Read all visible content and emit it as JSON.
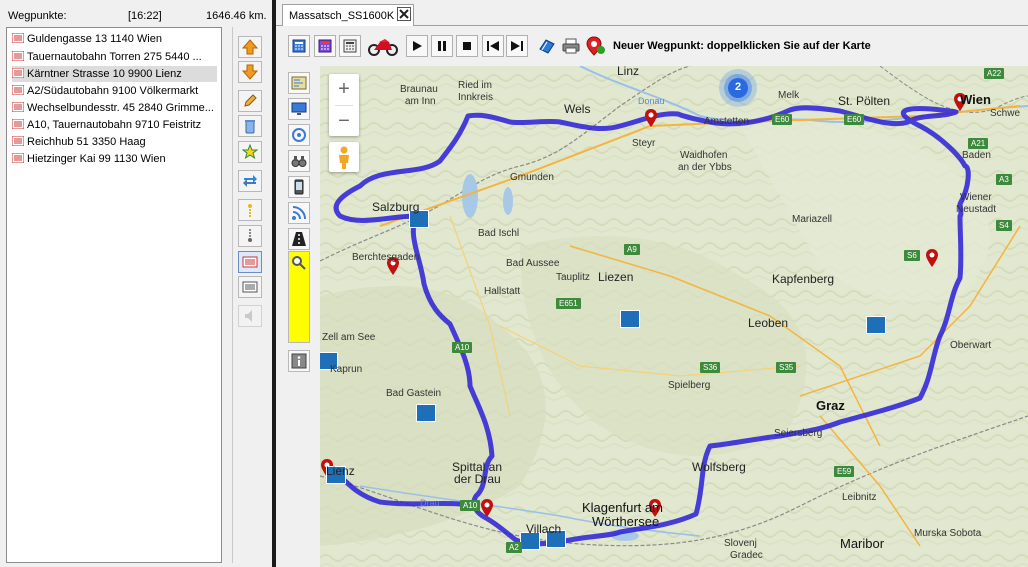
{
  "waypoints_panel": {
    "title": "Wegpunkte:",
    "time": "[16:22]",
    "distance": "1646.46 km.",
    "items": [
      {
        "label": "Guldengasse 13 1140 Wien"
      },
      {
        "label": "Tauernautobahn Torren 275 5440 ..."
      },
      {
        "label": "Kärntner Strasse 10 9900 Lienz",
        "selected": true
      },
      {
        "label": "A2/Südautobahn 9100 Völkermarkt"
      },
      {
        "label": "Wechselbundesstr. 45 2840 Grimme..."
      },
      {
        "label": "A10, Tauernautobahn 9710 Feistritz"
      },
      {
        "label": "Reichhub 51 3350 Haag"
      },
      {
        "label": "Hietzinger Kai 99 1130 Wien"
      }
    ]
  },
  "side_toolbar": {
    "icons": [
      "arrow-up-icon",
      "arrow-down-icon",
      "pencil-icon",
      "trash-icon",
      "star-icon",
      "swap-icon",
      "move-up-icon",
      "move-down-icon",
      "route-flag-icon",
      "route-list-icon",
      "speaker-icon"
    ]
  },
  "map_tab": {
    "label": "Massatsch_SS1600K"
  },
  "top_toolbar": {
    "hint": "Neuer Wegpunkt: doppelklicken Sie auf der Karte",
    "icons": [
      "calculator-icon",
      "calculator-red-icon",
      "calculator-grid-icon",
      "motorcycle-icon",
      "play-icon",
      "pause-icon",
      "stop-icon",
      "skip-back-icon",
      "skip-forward-icon",
      "edit-note-icon",
      "print-icon",
      "map-pin-icon"
    ]
  },
  "map_tools": {
    "icons": [
      "map-layer-icon",
      "monitor-icon",
      "target-icon",
      "binoculars-icon",
      "phone-icon",
      "rss-icon",
      "road-icon",
      "magnifier-icon",
      "info-icon"
    ]
  },
  "map": {
    "route_color": "#2a1fd8",
    "cluster_count": "2",
    "zoom_in": "+",
    "zoom_out": "−",
    "labels": [
      {
        "name": "label-linz",
        "text": "Linz"
      },
      {
        "name": "label-ried",
        "text": "Ried im"
      },
      {
        "name": "label-innkreis",
        "text": "Innkreis"
      },
      {
        "name": "label-braunau",
        "text": "Braunau"
      },
      {
        "name": "label-am-inn",
        "text": "am Inn"
      },
      {
        "name": "label-wels",
        "text": "Wels"
      },
      {
        "name": "label-donau",
        "text": "Donau"
      },
      {
        "name": "label-amstetten",
        "text": "Amstetten"
      },
      {
        "name": "label-melk",
        "text": "Melk"
      },
      {
        "name": "label-st-poelten",
        "text": "St. Pölten"
      },
      {
        "name": "label-wien",
        "text": "Wien"
      },
      {
        "name": "label-schwechat",
        "text": "Schwe"
      },
      {
        "name": "label-steyr",
        "text": "Steyr"
      },
      {
        "name": "label-waidhofen",
        "text": "Waidhofen"
      },
      {
        "name": "label-an-der-ybbs",
        "text": "an der Ybbs"
      },
      {
        "name": "label-baden",
        "text": "Baden"
      },
      {
        "name": "label-gmunden",
        "text": "Gmunden"
      },
      {
        "name": "label-wiener",
        "text": "Wiener"
      },
      {
        "name": "label-neustadt",
        "text": "Neustadt"
      },
      {
        "name": "label-salzburg",
        "text": "Salzburg"
      },
      {
        "name": "label-mariazell",
        "text": "Mariazell"
      },
      {
        "name": "label-bad-ischl",
        "text": "Bad Ischl"
      },
      {
        "name": "label-berchtesgaden",
        "text": "Berchtesgaden"
      },
      {
        "name": "label-bad-aussee",
        "text": "Bad Aussee"
      },
      {
        "name": "label-tauplitz",
        "text": "Tauplitz"
      },
      {
        "name": "label-liezen",
        "text": "Liezen"
      },
      {
        "name": "label-hallstatt",
        "text": "Hallstatt"
      },
      {
        "name": "label-kapfenberg",
        "text": "Kapfenberg"
      },
      {
        "name": "label-leoben",
        "text": "Leoben"
      },
      {
        "name": "label-zell-am-see",
        "text": "Zell am See"
      },
      {
        "name": "label-oberwart",
        "text": "Oberwart"
      },
      {
        "name": "label-kaprun",
        "text": "Kaprun"
      },
      {
        "name": "label-spielberg",
        "text": "Spielberg"
      },
      {
        "name": "label-bad-gastein",
        "text": "Bad Gastein"
      },
      {
        "name": "label-graz",
        "text": "Graz"
      },
      {
        "name": "label-seiersberg",
        "text": "Seiersberg"
      },
      {
        "name": "label-spittal",
        "text": "Spittal an"
      },
      {
        "name": "label-der-drau",
        "text": "der Drau"
      },
      {
        "name": "label-wolfsberg",
        "text": "Wolfsberg"
      },
      {
        "name": "label-lienz",
        "text": "Lienz"
      },
      {
        "name": "label-leibnitz",
        "text": "Leibnitz"
      },
      {
        "name": "label-villach",
        "text": "Villach"
      },
      {
        "name": "label-klagenfurt",
        "text": "Klagenfurt am"
      },
      {
        "name": "label-woerthersee",
        "text": "Wörthersee"
      },
      {
        "name": "label-drau",
        "text": "Drau"
      },
      {
        "name": "label-slovenj",
        "text": "Slovenj"
      },
      {
        "name": "label-gradec",
        "text": "Gradec"
      },
      {
        "name": "label-maribor",
        "text": "Maribor"
      },
      {
        "name": "label-murska",
        "text": "Murska Sobota"
      }
    ],
    "road_shields": [
      {
        "name": "shield-a22",
        "text": "A22"
      },
      {
        "name": "shield-a21",
        "text": "A21"
      },
      {
        "name": "shield-a3",
        "text": "A3"
      },
      {
        "name": "shield-s4",
        "text": "S4"
      },
      {
        "name": "shield-s6",
        "text": "S6"
      },
      {
        "name": "shield-a9",
        "text": "A9"
      },
      {
        "name": "shield-e651",
        "text": "E651"
      },
      {
        "name": "shield-a10",
        "text": "A10"
      },
      {
        "name": "shield-s36",
        "text": "S36"
      },
      {
        "name": "shield-s35",
        "text": "S35"
      },
      {
        "name": "shield-e59",
        "text": "E59"
      },
      {
        "name": "shield-a10b",
        "text": "A10"
      },
      {
        "name": "shield-a2",
        "text": "A2"
      },
      {
        "name": "shield-e60",
        "text": "E60"
      },
      {
        "name": "shield-e60b",
        "text": "E60"
      }
    ]
  }
}
